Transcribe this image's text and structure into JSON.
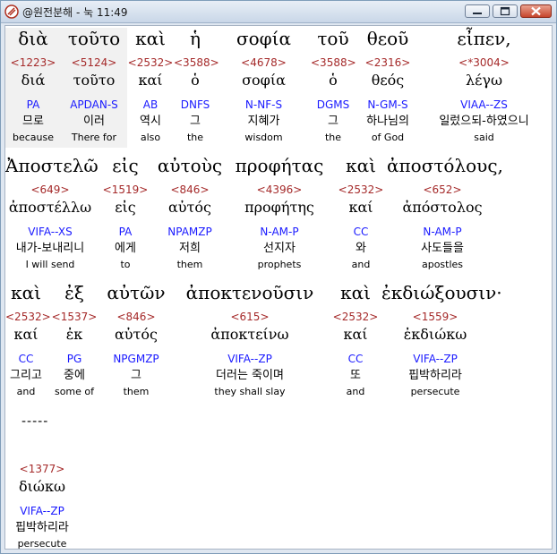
{
  "window": {
    "title": "@원전분해 - 눅 11:49",
    "app_icon": "scroll-icon",
    "buttons": {
      "minimize": "minimize-icon",
      "maximize": "maximize-icon",
      "close": "close-icon"
    }
  },
  "separator": "-----",
  "rows": [
    {
      "words": [
        {
          "greek": "διὰ",
          "strong": "<1223>",
          "lemma": "διά",
          "parse": "PA",
          "korean": "므로",
          "english": "because"
        },
        {
          "greek": "τοῦτο",
          "strong": "<5124>",
          "lemma": "τοῦτο",
          "parse": "APDAN-S",
          "korean": "이러",
          "english": "There for"
        },
        {
          "greek": "καὶ",
          "strong": "<2532>",
          "lemma": "καί",
          "parse": "AB",
          "korean": "역시",
          "english": "also"
        },
        {
          "greek": "ἡ",
          "strong": "<3588>",
          "lemma": "ὁ",
          "parse": "DNFS",
          "korean": "그",
          "english": "the"
        },
        {
          "greek": "σοφία",
          "strong": "<4678>",
          "lemma": "σοφία",
          "parse": "N-NF-S",
          "korean": "지혜가",
          "english": "wisdom"
        },
        {
          "greek": "τοῦ",
          "strong": "<3588>",
          "lemma": "ὁ",
          "parse": "DGMS",
          "korean": "그",
          "english": "the"
        },
        {
          "greek": "θεοῦ",
          "strong": "<2316>",
          "lemma": "θεός",
          "parse": "N-GM-S",
          "korean": "하나님의",
          "english": "of God"
        },
        {
          "greek": "εἶπεν,",
          "strong": "<*3004>",
          "lemma": "λέγω",
          "parse": "VIAA--ZS",
          "korean": "일렀으되-하였으니",
          "english": "said"
        }
      ]
    },
    {
      "words": [
        {
          "greek": "Ἀποστελῶ",
          "strong": "<649>",
          "lemma": "ἀποστέλλω",
          "parse": "VIFA--XS",
          "korean": "내가-보내리니",
          "english": "I will send"
        },
        {
          "greek": "εἰς",
          "strong": "<1519>",
          "lemma": "εἰς",
          "parse": "PA",
          "korean": "에게",
          "english": "to"
        },
        {
          "greek": "αὐτοὺς",
          "strong": "<846>",
          "lemma": "αὐτός",
          "parse": "NPAMZP",
          "korean": "저희",
          "english": "them"
        },
        {
          "greek": "προφήτας",
          "strong": "<4396>",
          "lemma": "προφήτης",
          "parse": "N-AM-P",
          "korean": "선지자",
          "english": "prophets"
        },
        {
          "greek": "καὶ",
          "strong": "<2532>",
          "lemma": "καί",
          "parse": "CC",
          "korean": "와",
          "english": "and"
        },
        {
          "greek": "ἀποστόλους,",
          "strong": "<652>",
          "lemma": "ἀπόστολος",
          "parse": "N-AM-P",
          "korean": "사도들을",
          "english": "apostles"
        }
      ]
    },
    {
      "words": [
        {
          "greek": "καὶ",
          "strong": "<2532>",
          "lemma": "καί",
          "parse": "CC",
          "korean": "그리고",
          "english": "and"
        },
        {
          "greek": "ἐξ",
          "strong": "<1537>",
          "lemma": "ἐκ",
          "parse": "PG",
          "korean": "중에",
          "english": "some of"
        },
        {
          "greek": "αὐτῶν",
          "strong": "<846>",
          "lemma": "αὐτός",
          "parse": "NPGMZP",
          "korean": "그",
          "english": "them"
        },
        {
          "greek": "ἀποκτενοῦσιν",
          "strong": "<615>",
          "lemma": "ἀποκτείνω",
          "parse": "VIFA--ZP",
          "korean": "더러는 죽이며",
          "english": "they shall slay"
        },
        {
          "greek": "καὶ",
          "strong": "<2532>",
          "lemma": "καί",
          "parse": "CC",
          "korean": "또",
          "english": "and"
        },
        {
          "greek": "ἐκδιώξουσιν·",
          "strong": "<1559>",
          "lemma": "ἐκδιώκω",
          "parse": "VIFA--ZP",
          "korean": "핍박하리라",
          "english": "persecute"
        }
      ]
    },
    {
      "words": [
        {
          "greek": "",
          "strong": "<1377>",
          "lemma": "διώκω",
          "parse": "VIFA--ZP",
          "korean": "핍박하리라",
          "english": "persecute"
        }
      ]
    }
  ]
}
